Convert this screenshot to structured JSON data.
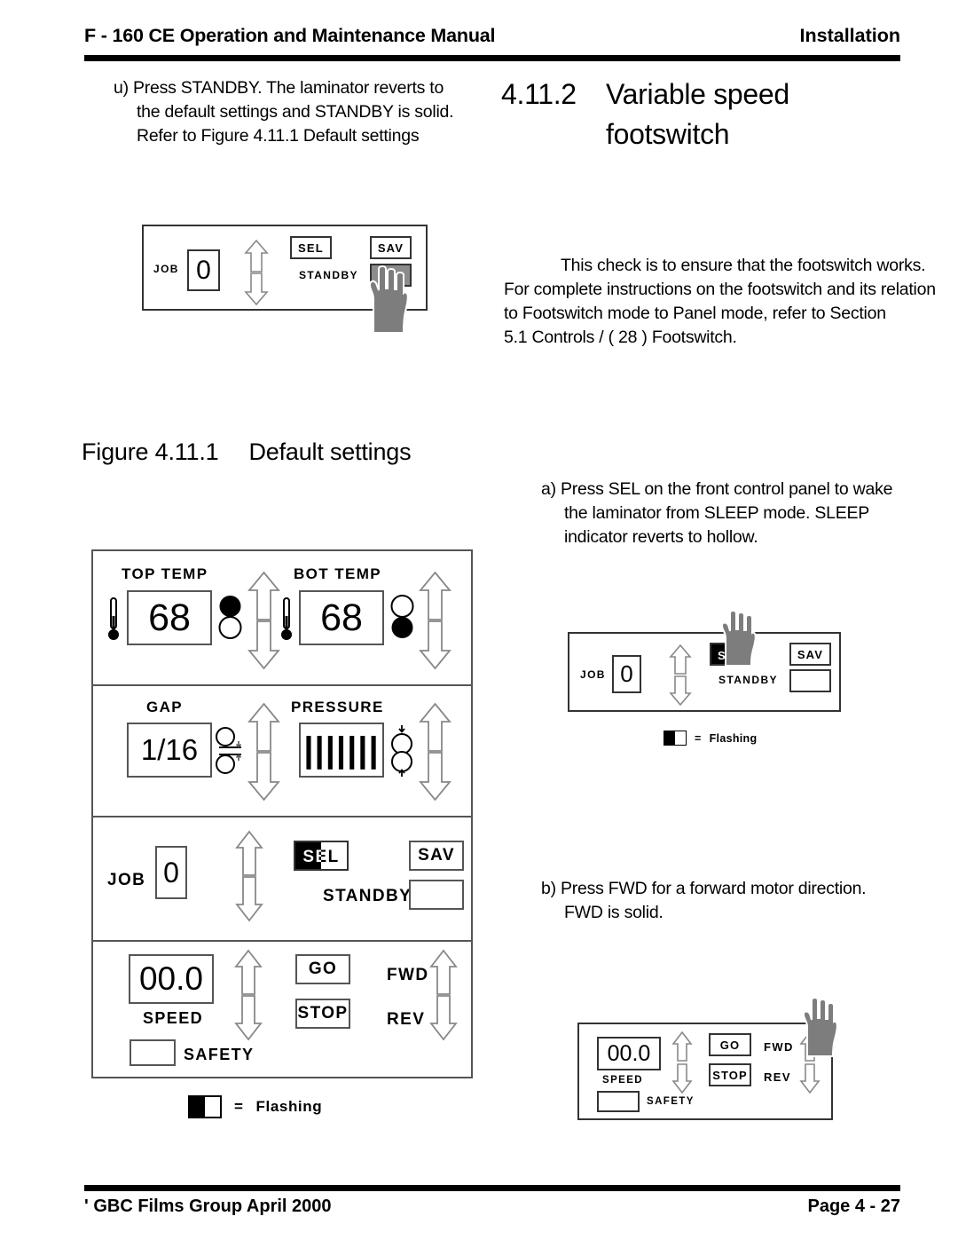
{
  "header": {
    "left": "F - 160 CE Operation and Maintenance  Manual",
    "right": "Installation"
  },
  "footer": {
    "left": "' GBC Films Group April 2000",
    "right": "Page 4 - 27"
  },
  "step_u": {
    "line1": "u) Press STANDBY. The laminator reverts to",
    "line2": "the default settings and STANDBY is solid.",
    "line3": "Refer to Figure 4.11.1 Default settings"
  },
  "section": {
    "number": "4.11.2",
    "title_line1": "Variable  speed",
    "title_line2": "footswitch"
  },
  "para_check": {
    "line1": "This check is to ensure that the footswitch works.",
    "line2": "For complete instructions on the footswitch and its relation",
    "line3": "to  Footswitch  mode to   Panel  mode, refer to Section",
    "line4": "5.1 Controls  / ( 28 ) Footswitch."
  },
  "figure_caption": {
    "number": "Figure 4.11.1",
    "text": "Default  settings"
  },
  "step_a": {
    "line1": "a) Press SEL on the front control panel to wake",
    "line2": "the laminator from SLEEP mode. SLEEP",
    "line3": "indicator reverts to hollow."
  },
  "step_b": {
    "line1": "b) Press FWD     for a forward motor direction.",
    "line2": "FWD is solid."
  },
  "panel_top": {
    "job_label": "JOB",
    "job_value": "0",
    "sel_label": "SEL",
    "sav_label": "SAV",
    "standby_label": "STANDBY",
    "standby_state": "pressed-solid"
  },
  "panel_default": {
    "top_temp": {
      "label": "TOP TEMP",
      "value": "68",
      "indicator": "top-filled"
    },
    "bot_temp": {
      "label": "BOT TEMP",
      "value": "68",
      "indicator": "bottom-filled"
    },
    "gap": {
      "label": "GAP",
      "value": "1/16"
    },
    "pressure": {
      "label": "PRESSURE",
      "value": "|||||||"
    },
    "job_label": "JOB",
    "job_value": "0",
    "sel_label": "SEL",
    "sel_state": "flashing",
    "sav_label": "SAV",
    "standby_label": "STANDBY",
    "standby_state": "hollow",
    "speed_value": "00.0",
    "speed_label": "SPEED",
    "safety_label": "SAFETY",
    "go_label": "GO",
    "stop_label": "STOP",
    "fwd_label": "FWD",
    "rev_label": "REV"
  },
  "panel_sel": {
    "job_label": "JOB",
    "job_value": "0",
    "sel_label": "SEL",
    "sel_state": "flashing",
    "sav_label": "SAV",
    "standby_label": "STANDBY",
    "standby_state": "hollow"
  },
  "panel_fwd": {
    "speed_value": "00.0",
    "speed_label": "SPEED",
    "safety_label": "SAFETY",
    "go_label": "GO",
    "stop_label": "STOP",
    "fwd_label": "FWD",
    "rev_label": "REV"
  },
  "legend": {
    "equals": "=",
    "text": "Flashing"
  },
  "colors": {
    "rule": "#000000",
    "panel_border": "#555555",
    "hand": "#7d7d7d",
    "pressed_key": "#8c8c8c"
  }
}
